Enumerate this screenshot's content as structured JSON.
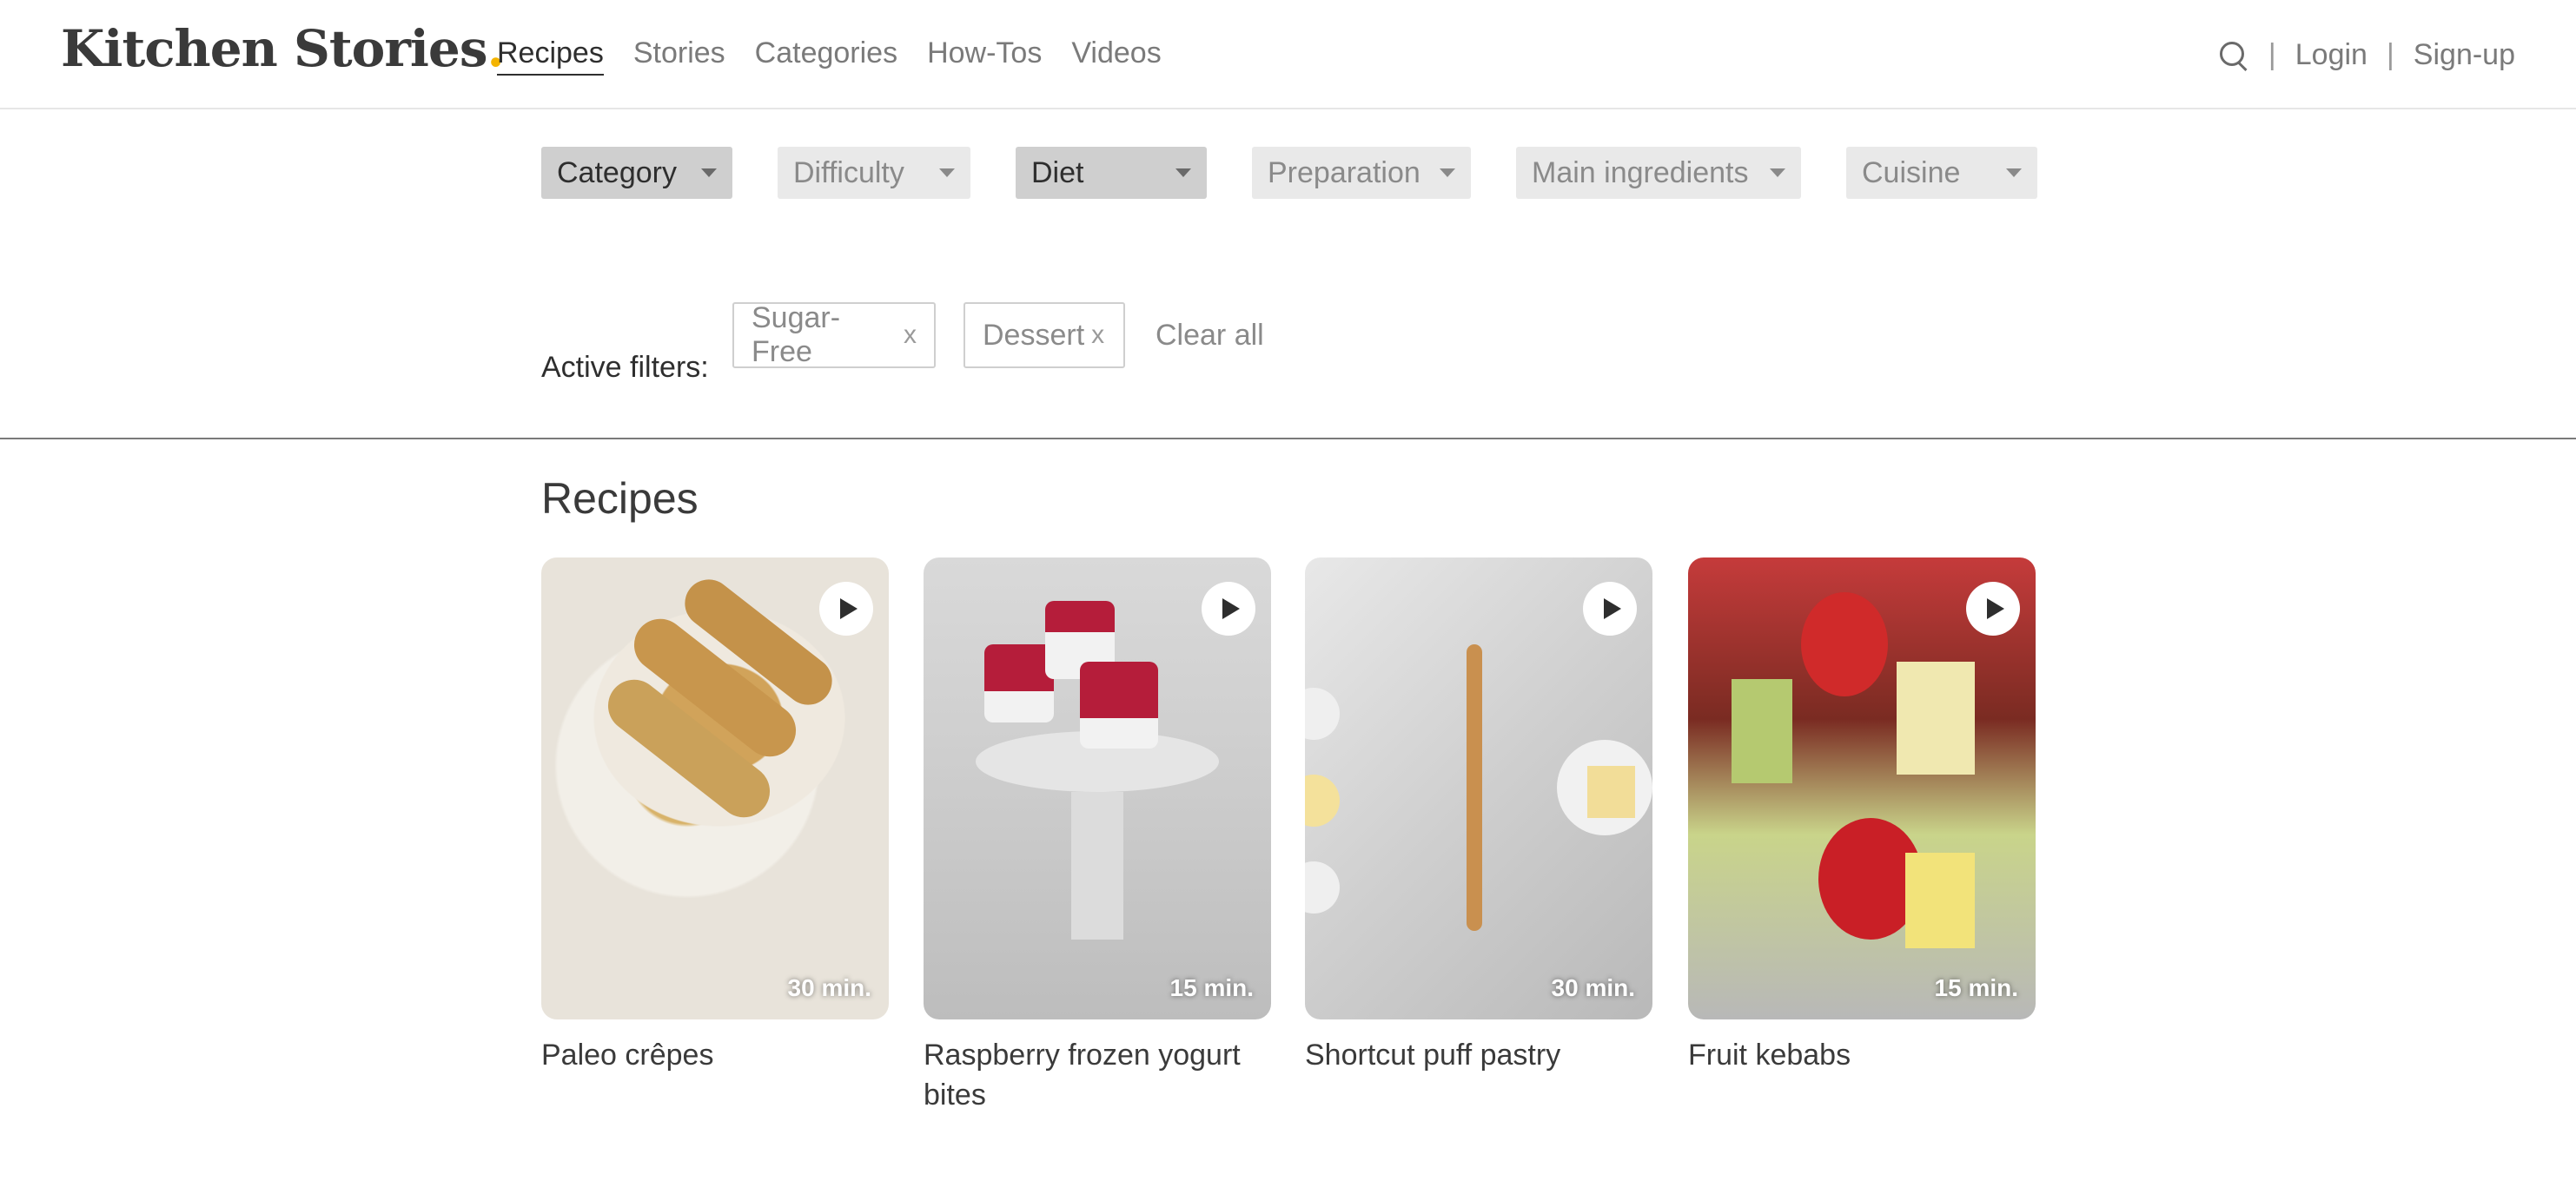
{
  "header": {
    "logo_text": "Kitchen Stories",
    "logo_dot": ".",
    "nav": [
      "Recipes",
      "Stories",
      "Categories",
      "How-Tos",
      "Videos"
    ],
    "login": "Login",
    "signup": "Sign-up",
    "sep": "|"
  },
  "filters": {
    "category": "Category",
    "difficulty": "Difficulty",
    "diet": "Diet",
    "preparation": "Preparation",
    "main": "Main ingredients",
    "cuisine": "Cuisine"
  },
  "active": {
    "label": "Active filters:",
    "chips": [
      "Sugar-Free",
      "Dessert"
    ],
    "remove": "x",
    "clear_all": "Clear all"
  },
  "recipes": {
    "title": "Recipes",
    "items": [
      {
        "title": "Paleo crêpes",
        "time": "30 min."
      },
      {
        "title": "Raspberry frozen yogurt bites",
        "time": "15 min."
      },
      {
        "title": "Shortcut puff pastry",
        "time": "30 min."
      },
      {
        "title": "Fruit kebabs",
        "time": "15 min."
      }
    ]
  },
  "colors": {
    "accent_dot": "#f4b400",
    "text": "#3a3a3a",
    "muted": "#8a8a8a"
  }
}
